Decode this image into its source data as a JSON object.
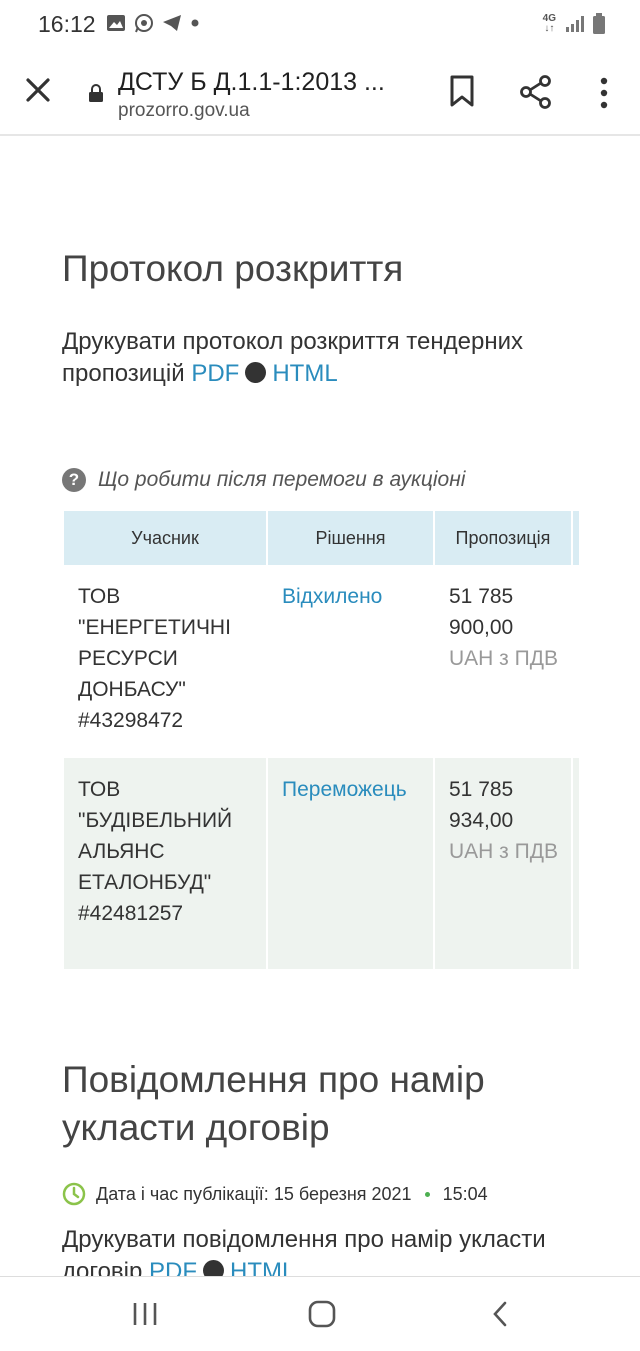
{
  "status_bar": {
    "time": "16:12",
    "network": "4G",
    "icons": [
      "image-icon",
      "whatsapp-icon",
      "telegram-icon",
      "dot-icon",
      "signal-icon",
      "battery-icon"
    ]
  },
  "toolbar": {
    "title": "ДСТУ Б Д.1.1-1:2013 ...",
    "url": "prozorro.gov.ua"
  },
  "protocol": {
    "heading": "Протокол розкриття",
    "print_text": "Друкувати протокол розкриття тендерних пропозицій",
    "pdf_link": "PDF",
    "html_link": "HTML"
  },
  "help": {
    "text": "Що робити після перемоги в аукціоні"
  },
  "bids_table": {
    "headers": [
      "Учасник",
      "Рішення",
      "Пропозиція"
    ],
    "rows": [
      {
        "participant": "ТОВ \"ЕНЕРГЕТИЧНІ РЕСУРСИ ДОНБАСУ\" #43298472",
        "decision": "Відхилено",
        "amount": "51 785 900,00",
        "currency": "UAH з ПДВ"
      },
      {
        "participant": "ТОВ \"БУДІВЕЛЬНИЙ АЛЬЯНС ЕТАЛОНБУД\" #42481257",
        "decision": "Переможець",
        "amount": "51 785 934,00",
        "currency": "UAH з ПДВ"
      }
    ]
  },
  "notice": {
    "heading": "Повідомлення про намір укласти договір",
    "pub_label": "Дата і час публікації:",
    "pub_date": "15 березня 2021",
    "pub_time": "15:04",
    "print_text": "Друкувати повідомлення про намір укласти договір",
    "pdf_link": "PDF",
    "html_link": "HTML"
  },
  "colors": {
    "link": "#2a8cbd",
    "table_header": "#d9ecf3",
    "winner_row": "#eef3ef",
    "clock_green": "#8bc34a"
  }
}
